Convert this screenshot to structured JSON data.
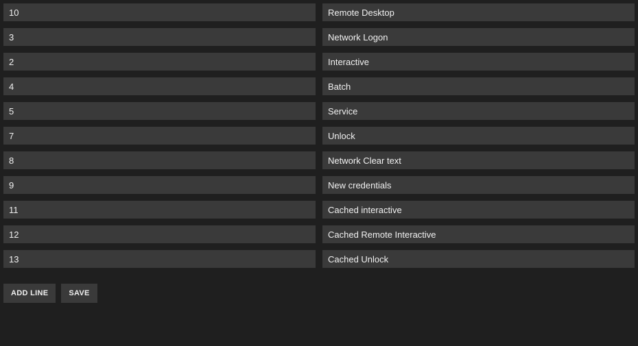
{
  "rows": [
    {
      "code": "10",
      "label": "Remote Desktop"
    },
    {
      "code": "3",
      "label": "Network Logon"
    },
    {
      "code": "2",
      "label": "Interactive"
    },
    {
      "code": "4",
      "label": "Batch"
    },
    {
      "code": "5",
      "label": "Service"
    },
    {
      "code": "7",
      "label": "Unlock"
    },
    {
      "code": "8",
      "label": "Network Clear text"
    },
    {
      "code": "9",
      "label": "New credentials"
    },
    {
      "code": "11",
      "label": "Cached interactive"
    },
    {
      "code": "12",
      "label": "Cached Remote Interactive"
    },
    {
      "code": "13",
      "label": "Cached Unlock"
    }
  ],
  "actions": {
    "add_line_label": "ADD LINE",
    "save_label": "SAVE"
  }
}
